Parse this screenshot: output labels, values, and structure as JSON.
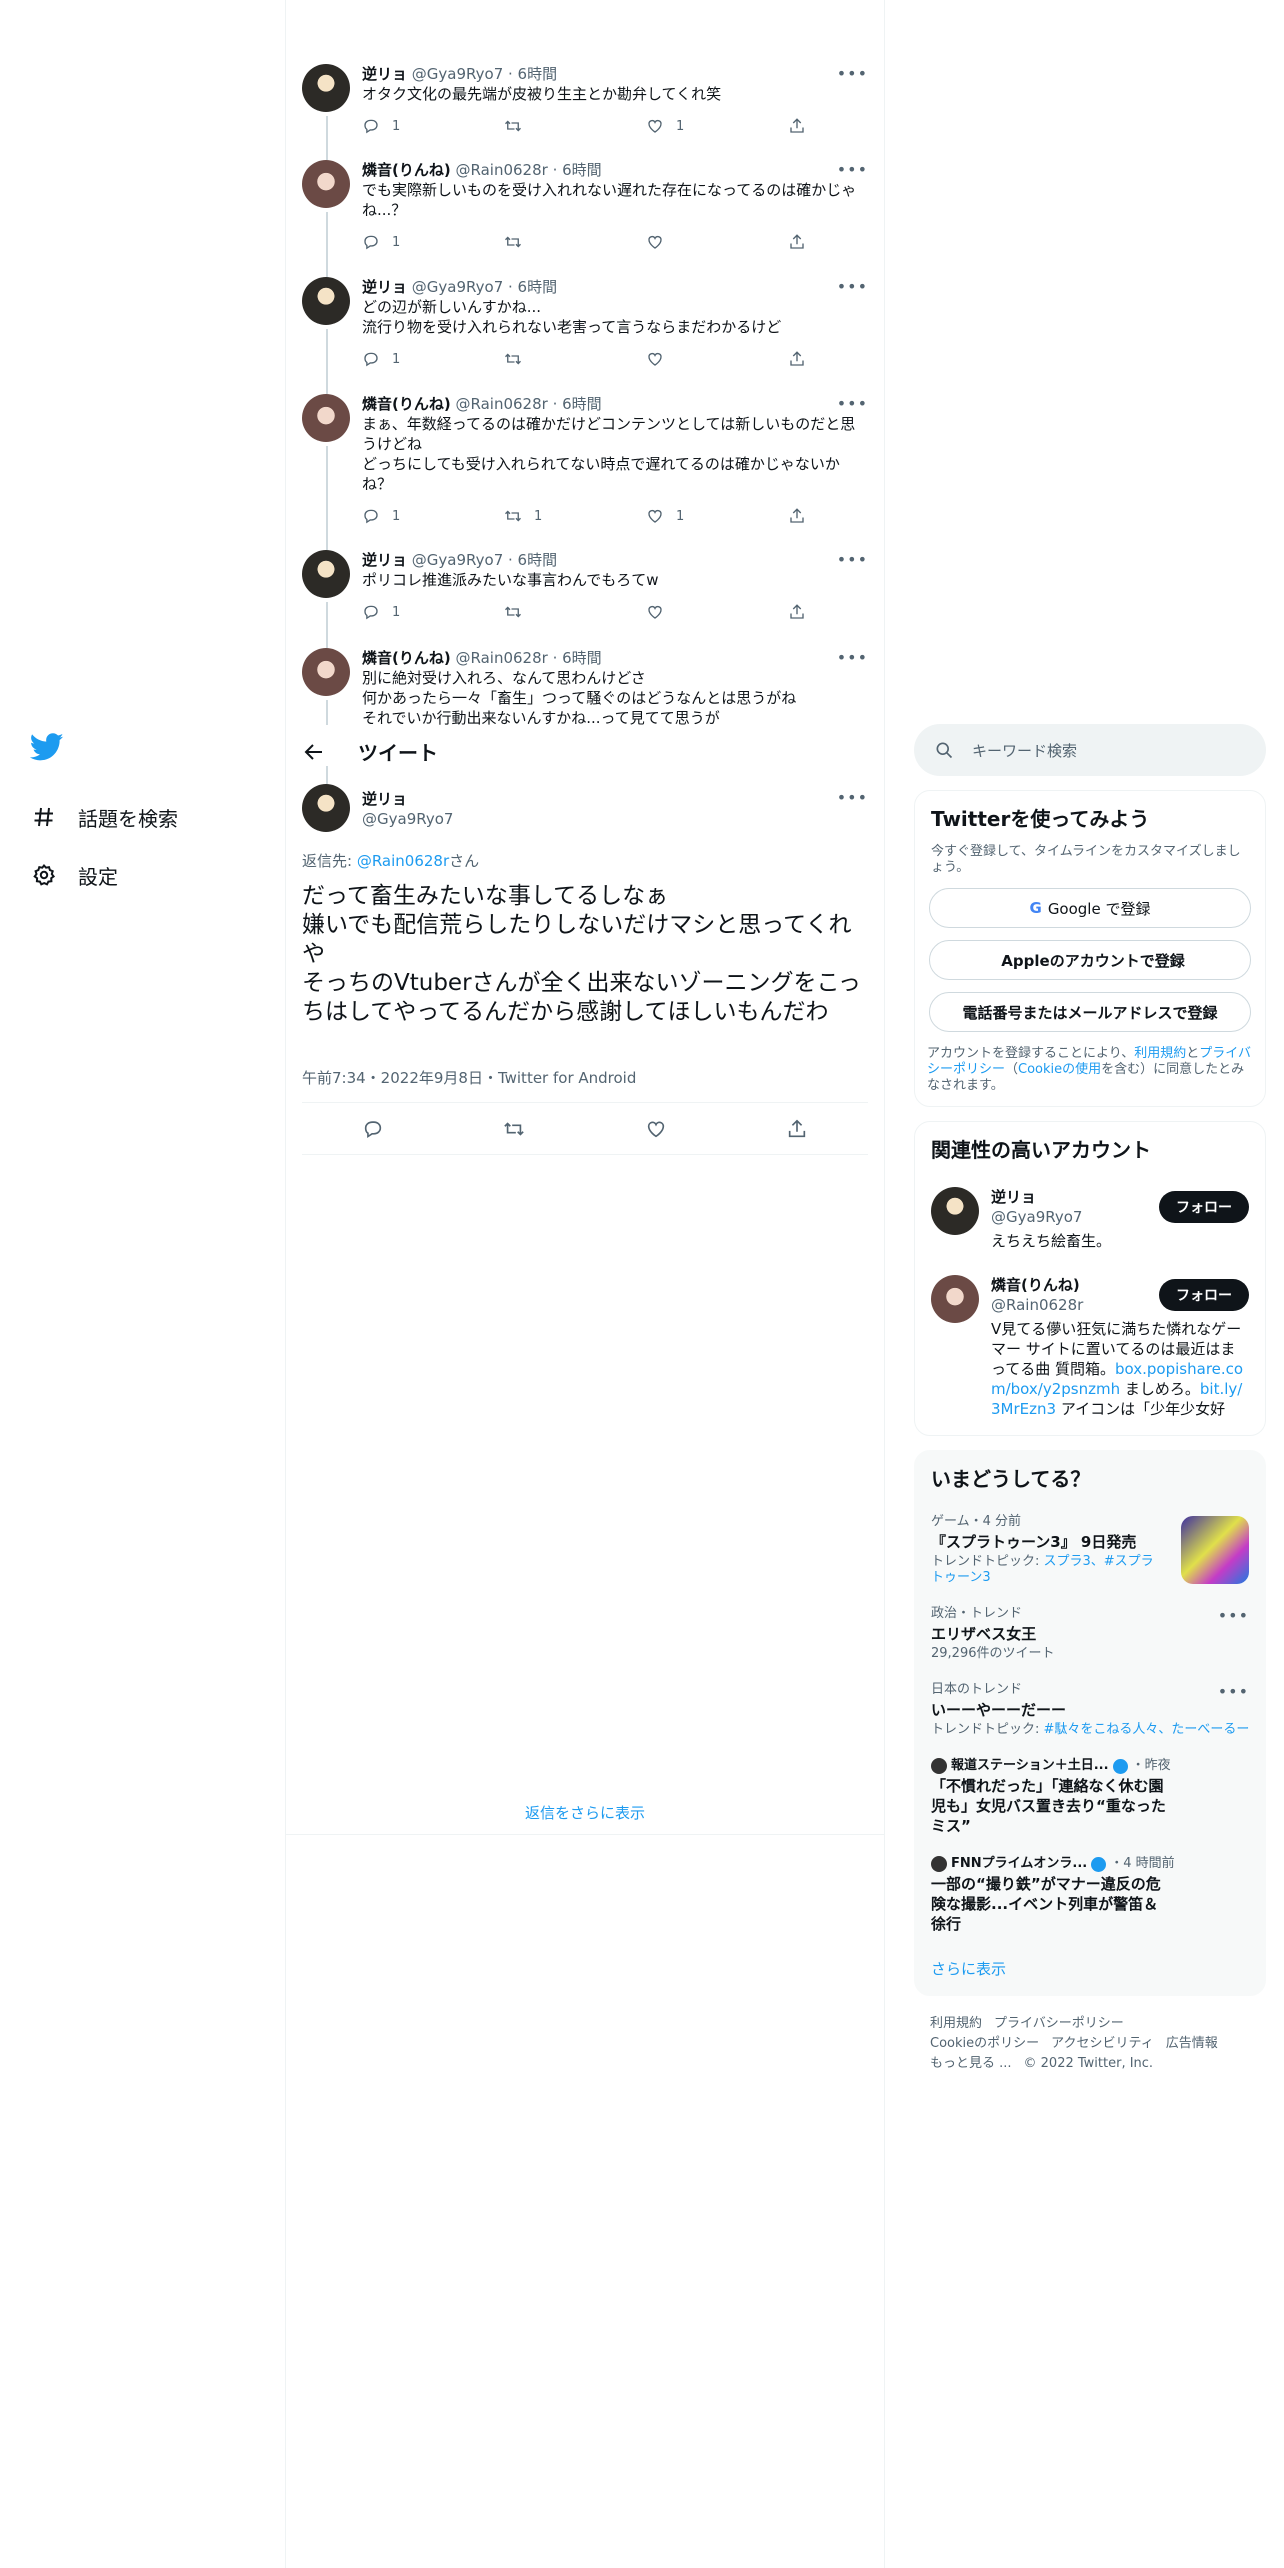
{
  "nav": {
    "explore": "話題を検索",
    "settings": "設定"
  },
  "thread": [
    {
      "name": "逆リョ",
      "handle": "@Gya9Ryo7",
      "time": "6時間",
      "text": "オタク文化の最先端が皮被り生主とか勘弁してくれ笑",
      "reply": "1",
      "retweet": "",
      "like": "1",
      "avatar": "1"
    },
    {
      "name": "燐音(りんね)",
      "handle": "@Rain0628r",
      "time": "6時間",
      "text": "でも実際新しいものを受け入れれない遅れた存在になってるのは確かじゃね...？",
      "reply": "1",
      "retweet": "",
      "like": "",
      "avatar": "2"
    },
    {
      "name": "逆リョ",
      "handle": "@Gya9Ryo7",
      "time": "6時間",
      "text": "どの辺が新しいんすかね...\n流行り物を受け入れられない老害って言うならまだわかるけど",
      "reply": "1",
      "retweet": "",
      "like": "",
      "avatar": "1"
    },
    {
      "name": "燐音(りんね)",
      "handle": "@Rain0628r",
      "time": "6時間",
      "text": "まぁ、年数経ってるのは確かだけどコンテンツとしては新しいものだと思うけどね\nどっちにしても受け入れられてない時点で遅れてるのは確かじゃないかね？",
      "reply": "1",
      "retweet": "1",
      "like": "1",
      "avatar": "2"
    },
    {
      "name": "逆リョ",
      "handle": "@Gya9Ryo7",
      "time": "6時間",
      "text": "ポリコレ推進派みたいな事言わんでもろてw",
      "reply": "1",
      "retweet": "",
      "like": "",
      "avatar": "1"
    },
    {
      "name": "燐音(りんね)",
      "handle": "@Rain0628r",
      "time": "6時間",
      "text": "別に絶対受け入れろ、なんて思わんけどさ\n何かあったら一々「畜生」つって騒ぐのはどうなんとは思うがね\nそれでいか行動出来ないんすかね...って見てて思うが",
      "reply": "",
      "retweet": "",
      "like": "",
      "avatar": "2"
    }
  ],
  "header": {
    "title": "ツイート"
  },
  "main": {
    "name": "逆リョ",
    "handle": "@Gya9Ryo7",
    "reply_prefix": "返信先: ",
    "reply_to": "@Rain0628r",
    "reply_suffix": "さん",
    "text": "だって畜生みたいな事してるしなぁ\n嫌いでも配信荒らしたりしないだけマシと思ってくれや\nそっちのVtuberさんが全く出来ないゾーニングをこっちはしてやってるんだから感謝してほしいもんだわ",
    "meta": "午前7:34・2022年9月8日・Twitter for Android"
  },
  "show_more_replies": "返信をさらに表示",
  "search": {
    "placeholder": "キーワード検索"
  },
  "signup": {
    "title": "Twitterを使ってみよう",
    "subtitle": "今すぐ登録して、タイムラインをカスタマイズしましょう。",
    "google": "Google で登録",
    "apple": "Appleのアカウントで登録",
    "phone": "電話番号またはメールアドレスで登録",
    "terms_1": "アカウントを登録することにより、",
    "terms_link1": "利用規約",
    "terms_2": "と",
    "terms_link2": "プライバシーポリシー",
    "terms_3": "（",
    "terms_link3": "Cookieの使用",
    "terms_4": "を含む）に同意したとみなされます。"
  },
  "related": {
    "title": "関連性の高いアカウント",
    "follow": "フォロー",
    "accounts": [
      {
        "name": "逆リョ",
        "handle": "@Gya9Ryo7",
        "bio": "えちえち絵畜生。"
      },
      {
        "name": "燐音(りんね)",
        "handle": "@Rain0628r",
        "bio_1": "V見てる儚い狂気に満ちた憐れなゲーマー サイトに置いてるのは最近はまってる曲 質問箱。",
        "bio_link1": "box.popishare.com/box/y2psnzmh",
        "bio_2": " ましめろ。",
        "bio_link2": "bit.ly/3MrEzn3",
        "bio_3": " アイコンは「少年少女好き？」で作りました"
      }
    ]
  },
  "trends": {
    "title": "いまどうしてる？",
    "items": [
      {
        "meta": "ゲーム・4 分前",
        "title": "『スプラトゥーン3』 9日発売",
        "sub_prefix": "トレンドトピック: ",
        "sub_links": "スプラ3、#スプラトゥーン3"
      },
      {
        "meta": "政治・トレンド",
        "title": "エリザベス女王",
        "sub": "29,296件のツイート"
      },
      {
        "meta": "日本のトレンド",
        "title": "いーーやーーだーー",
        "sub_prefix": "トレンドトピック: ",
        "sub_links": "#駄々をこねる人々、たーべーるー"
      }
    ],
    "news": [
      {
        "source": "報道ステーション＋土日...",
        "time": "・昨夜",
        "title": "「不慣れだった」「連絡なく休む園児も」女児バス置き去り“重なったミス”"
      },
      {
        "source": "FNNプライムオンラ...",
        "time": "・4 時間前",
        "title": "一部の“撮り鉄”がマナー違反の危険な撮影...イベント列車が警笛＆徐行"
      }
    ],
    "show_more": "さらに表示"
  },
  "footer": {
    "links": [
      "利用規約",
      "プライバシーポリシー",
      "Cookieのポリシー",
      "アクセシビリティ",
      "広告情報",
      "もっと見る ..."
    ],
    "copyright": "© 2022 Twitter, Inc."
  },
  "colors": {
    "accent": "#1d9bf0",
    "text": "#0f1419",
    "muted": "#536471",
    "border": "#eff3f4"
  }
}
